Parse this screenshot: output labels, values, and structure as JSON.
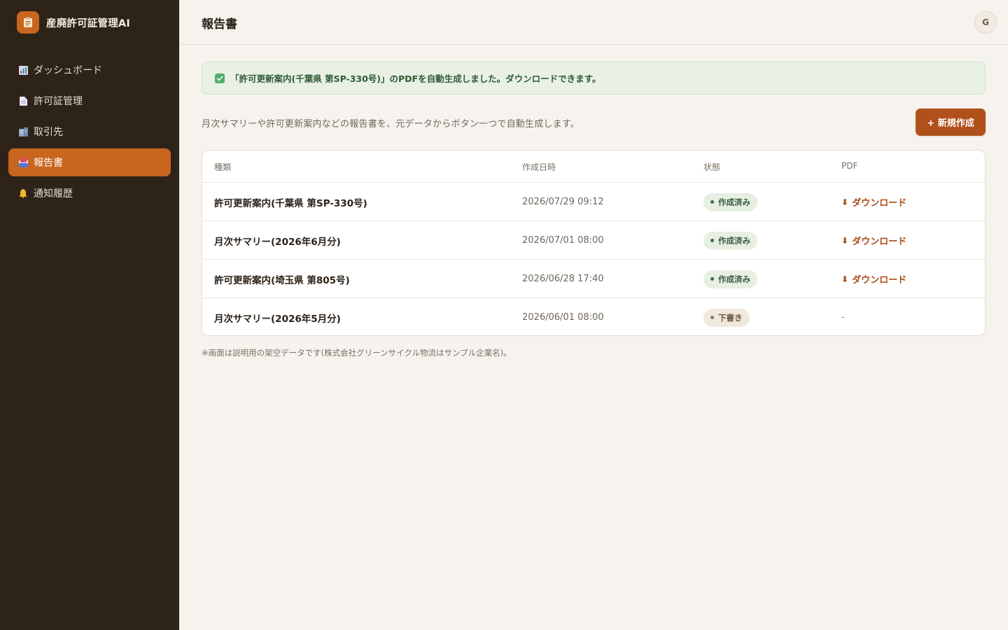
{
  "app": {
    "title": "産廃許可証管理AI",
    "logo_icon": "clipboard-icon",
    "accent": "#c8651f"
  },
  "sidebar": {
    "items": [
      {
        "label": "ダッシュボード",
        "icon": "bar-chart-icon",
        "active": false
      },
      {
        "label": "許可証管理",
        "icon": "document-icon",
        "active": false
      },
      {
        "label": "取引先",
        "icon": "building-icon",
        "active": false
      },
      {
        "label": "報告書",
        "icon": "inbox-icon",
        "active": true
      },
      {
        "label": "通知履歴",
        "icon": "bell-icon",
        "active": false
      }
    ]
  },
  "header": {
    "title": "報告書",
    "avatar_initial": "G"
  },
  "alert": {
    "icon": "check-icon",
    "text": "「許可更新案内(千葉県 第SP-330号)」のPDFを自動生成しました。ダウンロードできます。",
    "color": "#e8f1e4"
  },
  "main": {
    "description": "月次サマリーや許可更新案内などの報告書を、元データからボタン一つで自動生成します。",
    "new_button_label": "+ 新規作成",
    "footnote": "※画面は説明用の架空データです(株式会社グリーンサイクル物流はサンプル企業名)。"
  },
  "table": {
    "headers": [
      "種類",
      "作成日時",
      "状態",
      "PDF"
    ],
    "rows": [
      {
        "type": "許可更新案内(千葉県 第SP-330号)",
        "date": "2026/07/29 09:12",
        "status": "作成済み",
        "status_kind": "done",
        "pdf": "ダウンロード"
      },
      {
        "type": "月次サマリー(2026年6月分)",
        "date": "2026/07/01 08:00",
        "status": "作成済み",
        "status_kind": "done",
        "pdf": "ダウンロード"
      },
      {
        "type": "許可更新案内(埼玉県 第805号)",
        "date": "2026/06/28 17:40",
        "status": "作成済み",
        "status_kind": "done",
        "pdf": "ダウンロード"
      },
      {
        "type": "月次サマリー(2026年5月分)",
        "date": "2026/06/01 08:00",
        "status": "下書き",
        "status_kind": "draft",
        "pdf": "-"
      }
    ]
  }
}
